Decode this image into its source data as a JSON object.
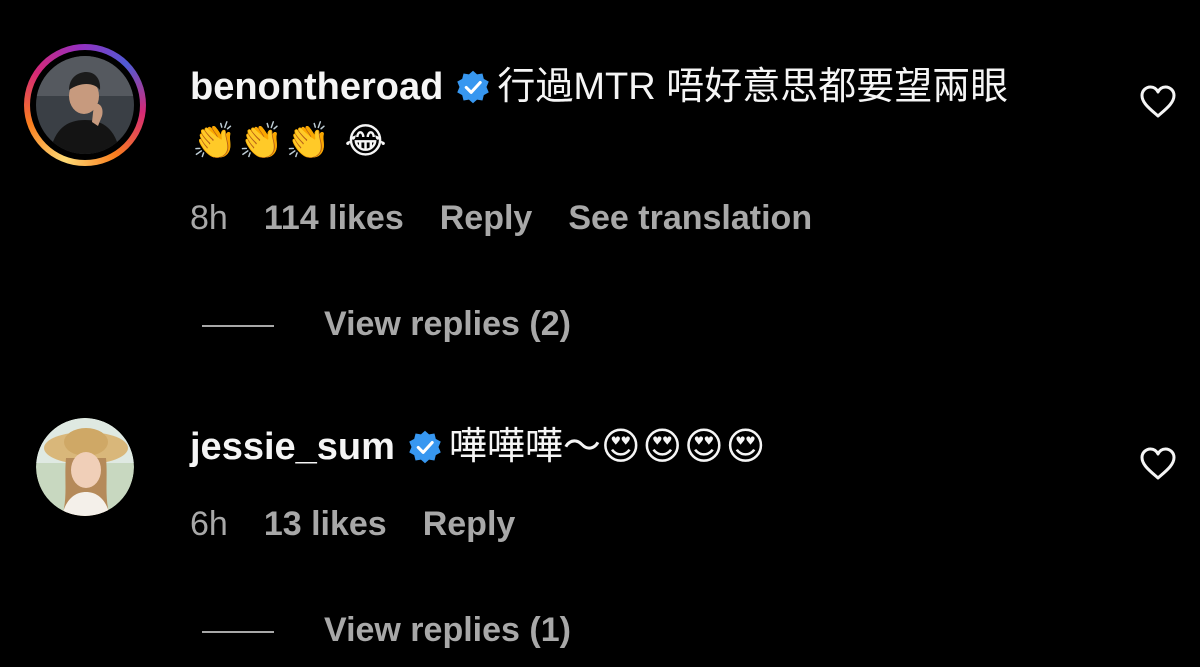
{
  "colors": {
    "background": "#000000",
    "text_primary": "#f5f5f5",
    "text_secondary": "#a8a8a8",
    "verified_blue": "#3797f0"
  },
  "comments": [
    {
      "username": "benontheroad",
      "verified": true,
      "has_story_ring": true,
      "text": "行過MTR 唔好意思都要望兩眼",
      "emoji_line": "👏👏👏 😂",
      "time": "8h",
      "likes": "114 likes",
      "reply_label": "Reply",
      "translate_label": "See translation",
      "view_replies": "View replies (2)",
      "like_icon": "heart-outline-icon"
    },
    {
      "username": "jessie_sum",
      "verified": true,
      "has_story_ring": false,
      "text": "嘩嘩嘩～",
      "emoji_inline": "😍😍😍😍",
      "time": "6h",
      "likes": "13 likes",
      "reply_label": "Reply",
      "view_replies": "View replies (1)",
      "like_icon": "heart-outline-icon"
    }
  ]
}
